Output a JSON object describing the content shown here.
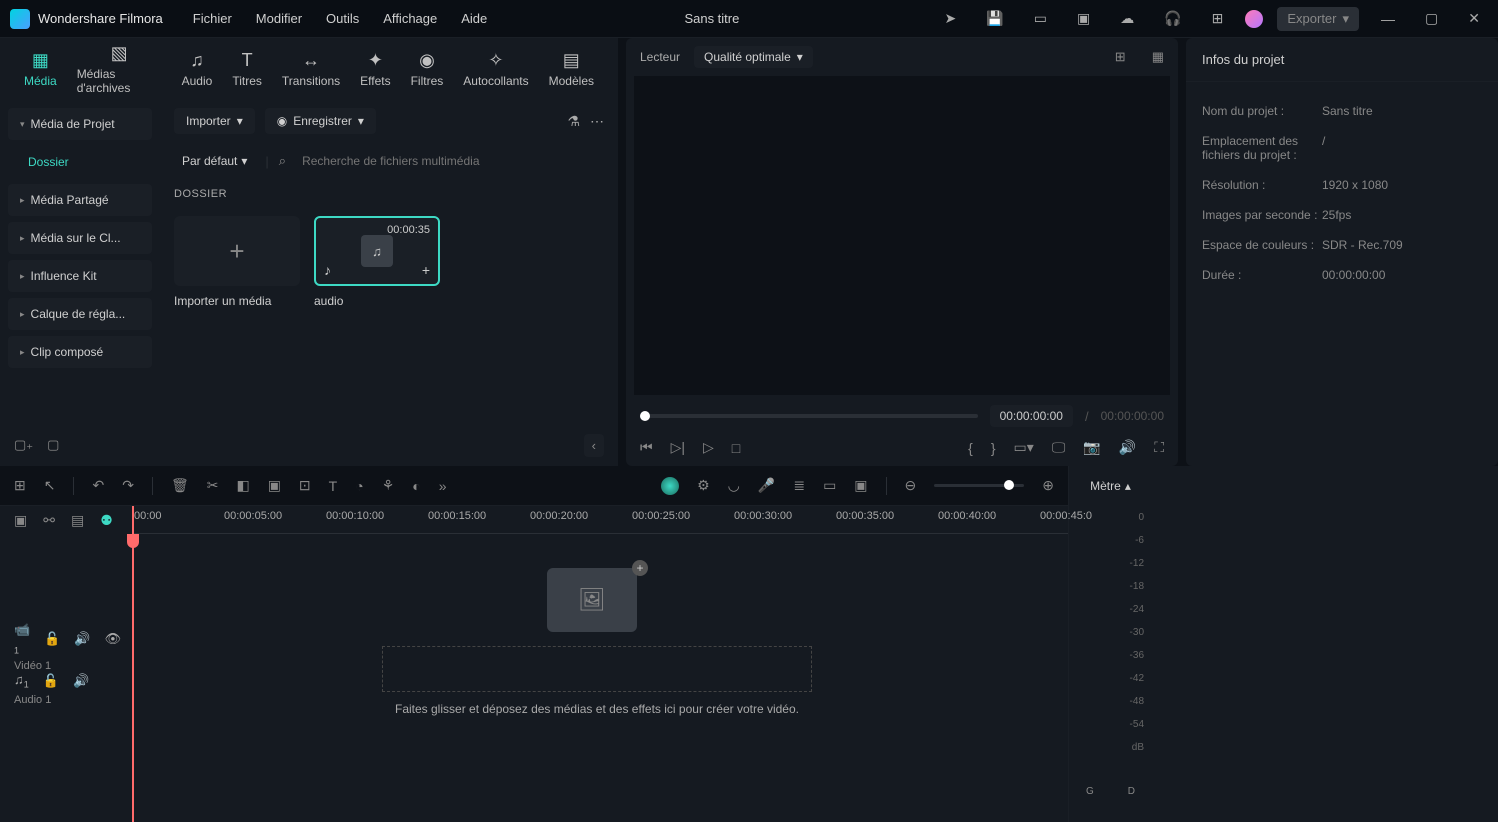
{
  "app_name": "Wondershare Filmora",
  "menu": [
    "Fichier",
    "Modifier",
    "Outils",
    "Affichage",
    "Aide"
  ],
  "title": "Sans titre",
  "export": "Exporter",
  "tabs": [
    {
      "label": "Média"
    },
    {
      "label": "Médias d'archives"
    },
    {
      "label": "Audio"
    },
    {
      "label": "Titres"
    },
    {
      "label": "Transitions"
    },
    {
      "label": "Effets"
    },
    {
      "label": "Filtres"
    },
    {
      "label": "Autocollants"
    },
    {
      "label": "Modèles"
    }
  ],
  "sidebar": {
    "items": [
      {
        "label": "Média de Projet"
      },
      {
        "label": "Dossier"
      },
      {
        "label": "Média Partagé"
      },
      {
        "label": "Média sur le Cl..."
      },
      {
        "label": "Influence Kit"
      },
      {
        "label": "Calque de régla..."
      },
      {
        "label": "Clip composé"
      }
    ]
  },
  "toolbar": {
    "import": "Importer",
    "record": "Enregistrer"
  },
  "sort": "Par défaut",
  "search_placeholder": "Recherche de fichiers multimédia",
  "folder_label": "DOSSIER",
  "thumbs": [
    {
      "name": "Importer un média"
    },
    {
      "name": "audio",
      "duration": "00:00:35"
    }
  ],
  "preview": {
    "lecteur": "Lecteur",
    "quality": "Qualité optimale",
    "current": "00:00:00:00",
    "total": "00:00:00:00"
  },
  "info": {
    "header": "Infos du projet",
    "rows": [
      {
        "label": "Nom du projet :",
        "value": "Sans titre"
      },
      {
        "label": "Emplacement des fichiers du projet :",
        "value": "/"
      },
      {
        "label": "Résolution :",
        "value": "1920 x 1080"
      },
      {
        "label": "Images par seconde :",
        "value": "25fps"
      },
      {
        "label": "Espace de couleurs :",
        "value": "SDR - Rec.709"
      },
      {
        "label": "Durée :",
        "value": "00:00:00:00"
      }
    ]
  },
  "timeline": {
    "ruler": [
      "00:00",
      "00:00:05:00",
      "00:00:10:00",
      "00:00:15:00",
      "00:00:20:00",
      "00:00:25:00",
      "00:00:30:00",
      "00:00:35:00",
      "00:00:40:00",
      "00:00:45:0"
    ],
    "video_track": "Vidéo 1",
    "audio_track": "Audio 1",
    "drop_text": "Faites glisser et déposez des médias et des effets ici pour créer votre vidéo."
  },
  "meter": {
    "label": "Mètre",
    "ticks": [
      "0",
      "-6",
      "-12",
      "-18",
      "-24",
      "-30",
      "-36",
      "-42",
      "-48",
      "-54",
      "dB"
    ],
    "left": "G",
    "right": "D"
  }
}
